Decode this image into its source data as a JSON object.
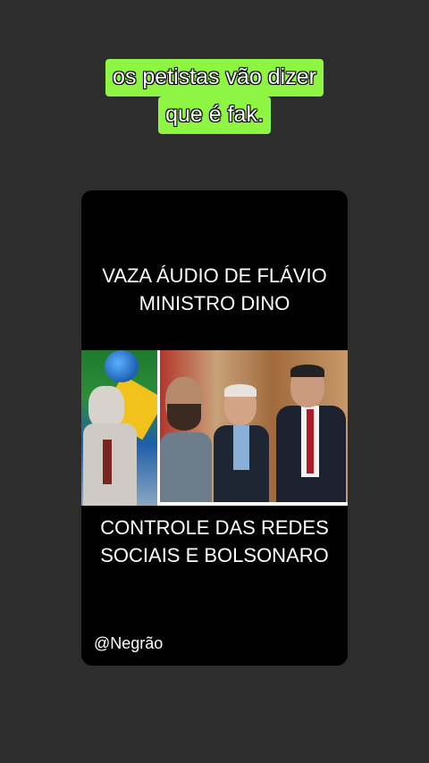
{
  "caption": {
    "line1": "os petistas vão dizer",
    "line2": "que é fak."
  },
  "card": {
    "title_line1": "VAZA  ÁUDIO DE FLÁVIO",
    "title_line2": "MINISTRO DINO",
    "subtitle_line1": "CONTROLE DAS REDES",
    "subtitle_line2": "SOCIAIS E BOLSONARO",
    "handle": "@Negrão"
  },
  "colors": {
    "background": "#2d2d2d",
    "caption_highlight": "#8ef542",
    "card": "#000000"
  }
}
